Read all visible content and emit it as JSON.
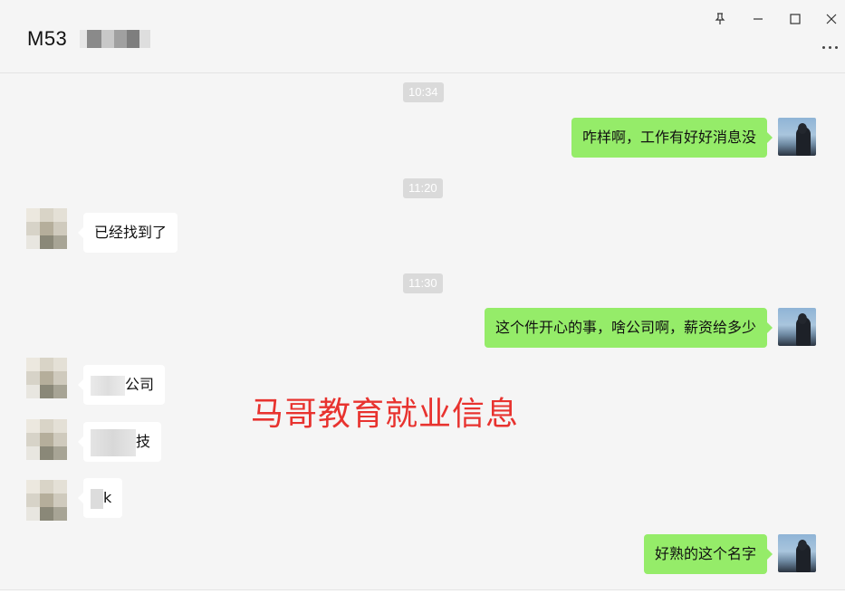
{
  "header": {
    "title": "M53",
    "controls": {
      "pin": "pin-icon",
      "minimize": "minimize-icon",
      "maximize": "maximize-icon",
      "close": "close-icon",
      "more": "more-icon"
    }
  },
  "colors": {
    "sent_bubble": "#95ec69",
    "received_bubble": "#ffffff",
    "background": "#f5f5f5",
    "watermark": "#e8332f"
  },
  "messages": [
    {
      "type": "time",
      "text": "10:34"
    },
    {
      "type": "sent",
      "text": "咋样啊，工作有好好消息没"
    },
    {
      "type": "time",
      "text": "11:20"
    },
    {
      "type": "received",
      "text": "已经找到了"
    },
    {
      "type": "time",
      "text": "11:30"
    },
    {
      "type": "sent",
      "text": "这个件开心的事，啥公司啊，薪资给多少"
    },
    {
      "type": "received",
      "text": "公司"
    },
    {
      "type": "received",
      "text": "技"
    },
    {
      "type": "received",
      "text": "k"
    },
    {
      "type": "sent",
      "text": "好熟的这个名字"
    }
  ],
  "watermark": "马哥教育就业信息"
}
